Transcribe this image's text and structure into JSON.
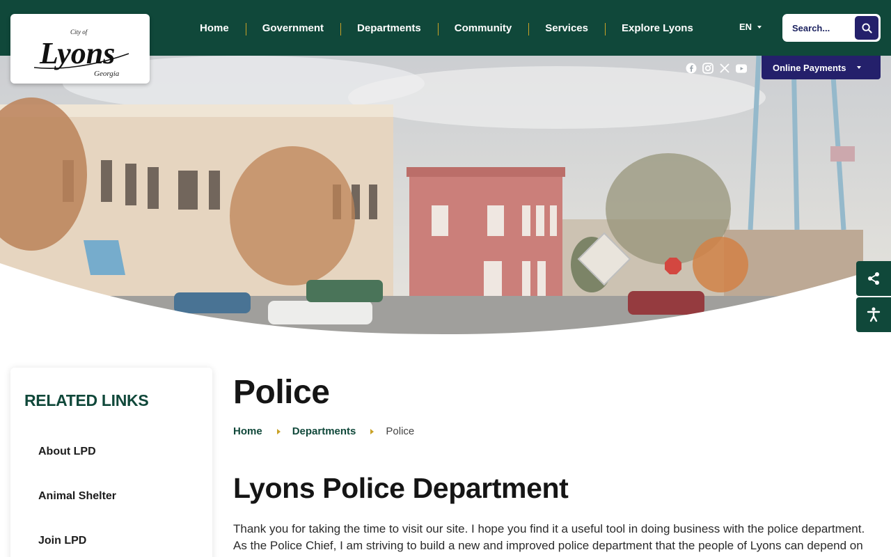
{
  "header": {
    "logo": {
      "city_of": "City of",
      "name": "Lyons",
      "state": "Georgia"
    },
    "nav": [
      "Home",
      "Government",
      "Departments",
      "Community",
      "Services",
      "Explore Lyons"
    ],
    "language": "EN",
    "search_placeholder": "Search...",
    "online_payments": "Online Payments"
  },
  "social_icons": [
    "facebook-icon",
    "instagram-icon",
    "x-icon",
    "youtube-icon"
  ],
  "side_tabs": [
    "share-icon",
    "accessibility-icon"
  ],
  "sidebar": {
    "title": "RELATED LINKS",
    "links": [
      "About LPD",
      "Animal Shelter",
      "Join LPD"
    ]
  },
  "page": {
    "title": "Police",
    "breadcrumb": [
      "Home",
      "Departments"
    ],
    "breadcrumb_current": "Police",
    "section_title": "Lyons Police Department",
    "intro": "Thank you for taking the time to visit our site. I hope you find it a useful tool in doing business with the police department. As the Police Chief, I am striving to build a new and improved police department that the people of Lyons can depend on"
  },
  "colors": {
    "primary_green": "#10483a",
    "accent_gold": "#c9a227",
    "navy": "#24206b"
  }
}
